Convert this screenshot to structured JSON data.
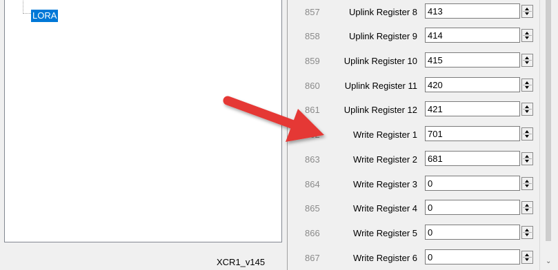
{
  "tree": {
    "node_label": "LORA"
  },
  "version_label": "XCR1_v145",
  "registers": [
    {
      "index": "857",
      "name": "Uplink Register 8",
      "value": "413"
    },
    {
      "index": "858",
      "name": "Uplink Register 9",
      "value": "414"
    },
    {
      "index": "859",
      "name": "Uplink Register 10",
      "value": "415"
    },
    {
      "index": "860",
      "name": "Uplink Register 11",
      "value": "420"
    },
    {
      "index": "861",
      "name": "Uplink Register 12",
      "value": "421"
    },
    {
      "index": "862",
      "name": "Write Register 1",
      "value": "701"
    },
    {
      "index": "863",
      "name": "Write Register 2",
      "value": "681"
    },
    {
      "index": "864",
      "name": "Write Register 3",
      "value": "0"
    },
    {
      "index": "865",
      "name": "Write Register 4",
      "value": "0"
    },
    {
      "index": "866",
      "name": "Write Register 5",
      "value": "0"
    },
    {
      "index": "867",
      "name": "Write Register 6",
      "value": "0"
    }
  ],
  "icons": {
    "spinner": "up-down-spinner-icon",
    "annotation": "red-arrow-icon",
    "scroll": "chevron-down-icon"
  },
  "colors": {
    "selection": "#0078d7",
    "arrow": "#e53935"
  }
}
